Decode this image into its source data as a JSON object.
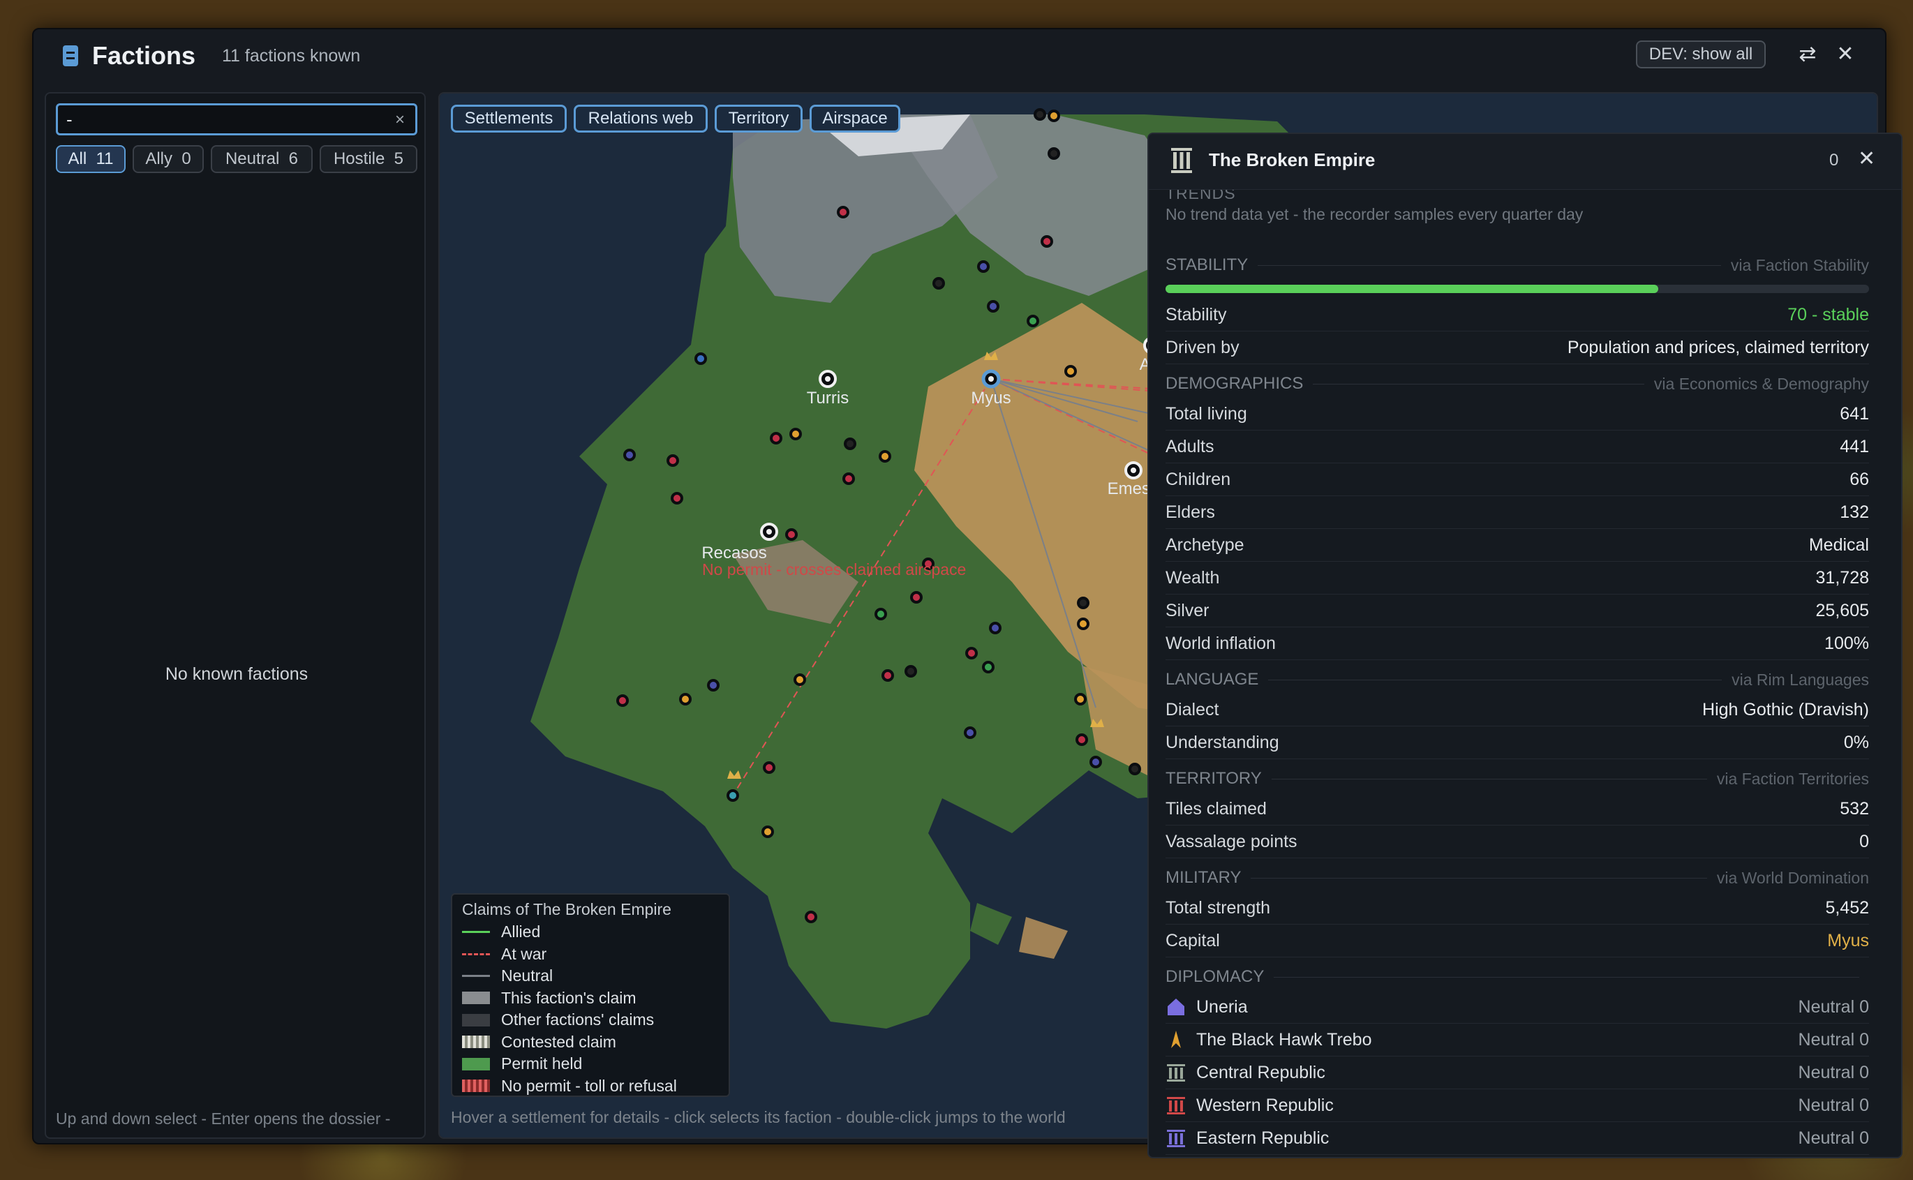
{
  "window": {
    "title": "Factions",
    "count_text": "11 factions known",
    "dev_button": "DEV: show all",
    "swap_glyph": "⇄",
    "close_glyph": "✕"
  },
  "search": {
    "value": "-",
    "clear_glyph": "×"
  },
  "filters": [
    {
      "label": "All",
      "count": "11",
      "active": true
    },
    {
      "label": "Ally",
      "count": "0"
    },
    {
      "label": "Neutral",
      "count": "6"
    },
    {
      "label": "Hostile",
      "count": "5"
    }
  ],
  "left": {
    "empty_text": "No known factions",
    "hint": "Up and down select - Enter opens the dossier -"
  },
  "map": {
    "tabs": [
      "Settlements",
      "Relations web",
      "Territory",
      "Airspace"
    ],
    "hint": "Hover a settlement for details - click selects its faction - double-click jumps to the world",
    "warning": "No permit - crosses claimed airspace",
    "settlements": [
      "Turris",
      "Myus",
      "Attalia",
      "Emesa",
      "Recasos"
    ],
    "legend": {
      "title": "Claims of The Broken Empire",
      "items": [
        "Allied",
        "At war",
        "Neutral",
        "This faction's claim",
        "Other factions' claims",
        "Contested claim",
        "Permit held",
        "No permit - toll or refusal"
      ]
    },
    "colors": {
      "allied": "#5ad05a",
      "at_war": "#e05555",
      "neutral": "#7b8088",
      "ocean": "#1c2a3c",
      "forest": "#3f6a36",
      "desert": "#b8925a",
      "snow": "#c9ccd0"
    }
  },
  "dossier": {
    "name": "The Broken Empire",
    "counter": "0",
    "close_glyph": "✕",
    "trends_heading": "TRENDS",
    "trend_note": "No trend data yet - the recorder samples every quarter day",
    "stability": {
      "heading": "STABILITY",
      "source": "via Faction Stability",
      "level": 0.7,
      "rows": [
        {
          "label": "Stability",
          "value": "70 - stable",
          "color": "#5ad05a"
        },
        {
          "label": "Driven by",
          "value": "Population and prices, claimed territory"
        }
      ]
    },
    "demographics": {
      "heading": "DEMOGRAPHICS",
      "source": "via Economics & Demography",
      "rows": [
        {
          "label": "Total living",
          "value": "641"
        },
        {
          "label": "Adults",
          "value": "441"
        },
        {
          "label": "Children",
          "value": "66"
        },
        {
          "label": "Elders",
          "value": "132"
        },
        {
          "label": "Archetype",
          "value": "Medical"
        },
        {
          "label": "Wealth",
          "value": "31,728"
        },
        {
          "label": "Silver",
          "value": "25,605"
        },
        {
          "label": "World inflation",
          "value": "100%"
        }
      ]
    },
    "language": {
      "heading": "LANGUAGE",
      "source": "via Rim Languages",
      "rows": [
        {
          "label": "Dialect",
          "value": "High Gothic (Dravish)"
        },
        {
          "label": "Understanding",
          "value": "0%"
        }
      ]
    },
    "territory": {
      "heading": "TERRITORY",
      "source": "via Faction Territories",
      "rows": [
        {
          "label": "Tiles claimed",
          "value": "532"
        },
        {
          "label": "Vassalage points",
          "value": "0"
        }
      ]
    },
    "military": {
      "heading": "MILITARY",
      "source": "via World Domination",
      "rows": [
        {
          "label": "Total strength",
          "value": "5,452"
        },
        {
          "label": "Capital",
          "value": "Myus",
          "color": "#e0b048"
        }
      ]
    },
    "diplomacy": {
      "heading": "DIPLOMACY",
      "rows": [
        {
          "name": "Uneria",
          "value": "Neutral 0",
          "icon": "house-icon",
          "icon_color": "#7a6ee0"
        },
        {
          "name": "The Black Hawk Trebo",
          "value": "Neutral 0",
          "icon": "spear-icon",
          "icon_color": "#e0a030"
        },
        {
          "name": "Central Republic",
          "value": "Neutral 0",
          "icon": "pillars-icon",
          "icon_color": "#9aa89a"
        },
        {
          "name": "Western Republic",
          "value": "Neutral 0",
          "icon": "pillars-icon",
          "icon_color": "#d04848"
        },
        {
          "name": "Eastern Republic",
          "value": "Neutral 0",
          "icon": "pillars-icon",
          "icon_color": "#7a70d8"
        }
      ]
    }
  }
}
